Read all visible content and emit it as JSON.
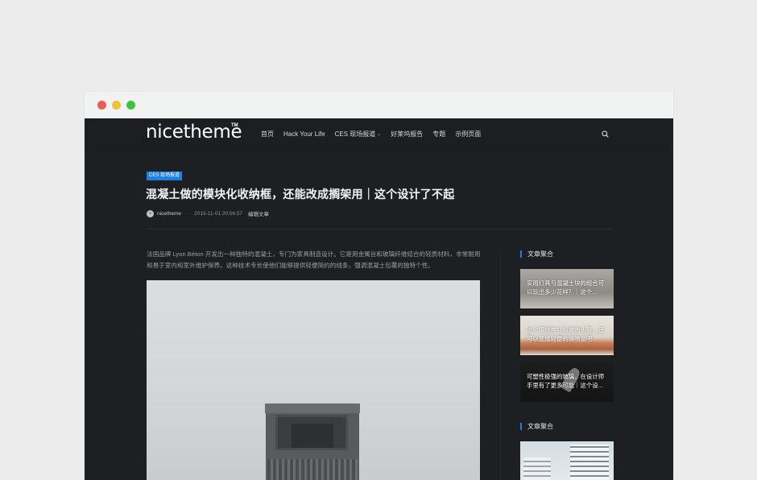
{
  "window": {
    "traffic_lights": [
      "close",
      "minimize",
      "maximize"
    ]
  },
  "nav": {
    "logo": "nicetheme",
    "logo_tm": "TM",
    "items": [
      {
        "label": "首页"
      },
      {
        "label": "Hack Your Life"
      },
      {
        "label": "CES 现场报道",
        "has_dropdown": true
      },
      {
        "label": "好莱坞报告"
      },
      {
        "label": "专题"
      },
      {
        "label": "示例页面"
      }
    ],
    "search_icon": "search-icon"
  },
  "article": {
    "category": "CES 现场报道",
    "title": "混凝土做的模块化收纳框，还能改成搁架用｜这个设计了不起",
    "author": "nicetheme",
    "separator": "·",
    "date": "2019-11-01 20:56:57",
    "edit_label": "编辑文章",
    "intro": "法国品牌 Lyon Béton 开发出一种独特的混凝土，专门为家具制造设计。它是用金属丝和玻璃纤维结合的轻质材料，非常耐用和易于室内和室外维护保养。这种技术专长使他们能够提供轻便简约的线条，强调混凝土包覆的独特个性。"
  },
  "sidebar": {
    "section1_title": "文章聚合",
    "section2_title": "文章聚合",
    "cards": [
      {
        "caption": "实用灯具与混凝土块的组合可以玩出多少花样？｜这个..."
      },
      {
        "caption": "这个用拉伸材料做的头盔，还可以变成轻便的储物盒吧..."
      },
      {
        "caption": "可塑性极强的玻璃，在设计师手里有了更多可能｜这个设..."
      }
    ]
  },
  "colors": {
    "accent": "#1e7fe0",
    "background": "#1d1f22",
    "title_text": "#f2f3f4"
  }
}
